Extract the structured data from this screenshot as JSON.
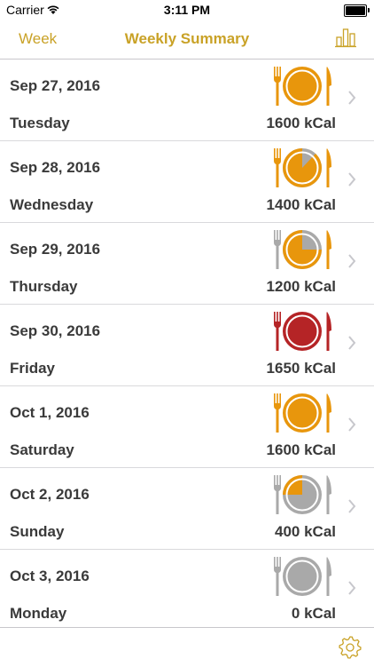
{
  "status": {
    "carrier": "Carrier",
    "time": "3:11 PM"
  },
  "nav": {
    "left_label": "Week",
    "title": "Weekly Summary"
  },
  "colors": {
    "accent": "#c9a227",
    "orange": "#e8960c",
    "red": "#b52426",
    "gray": "#a9a9a9"
  },
  "days": [
    {
      "date": "Sep 27, 2016",
      "weekday": "Tuesday",
      "kcal": "1600 kCal",
      "fill_fraction": 1.0,
      "state": "full"
    },
    {
      "date": "Sep 28, 2016",
      "weekday": "Wednesday",
      "kcal": "1400 kCal",
      "fill_fraction": 0.88,
      "state": "partial"
    },
    {
      "date": "Sep 29, 2016",
      "weekday": "Thursday",
      "kcal": "1200 kCal",
      "fill_fraction": 0.75,
      "state": "partial"
    },
    {
      "date": "Sep 30, 2016",
      "weekday": "Friday",
      "kcal": "1650 kCal",
      "fill_fraction": 1.0,
      "state": "over"
    },
    {
      "date": "Oct 1, 2016",
      "weekday": "Saturday",
      "kcal": "1600 kCal",
      "fill_fraction": 1.0,
      "state": "full"
    },
    {
      "date": "Oct 2, 2016",
      "weekday": "Sunday",
      "kcal": "400 kCal",
      "fill_fraction": 0.25,
      "state": "partial"
    },
    {
      "date": "Oct 3, 2016",
      "weekday": "Monday",
      "kcal": "0 kCal",
      "fill_fraction": 0.0,
      "state": "empty"
    }
  ],
  "icons": {
    "nav_right": "bar-chart-icon",
    "row_indicator": "plate-fork-knife-icon",
    "row_disclosure": "chevron-right-icon",
    "toolbar": "gear-icon"
  }
}
